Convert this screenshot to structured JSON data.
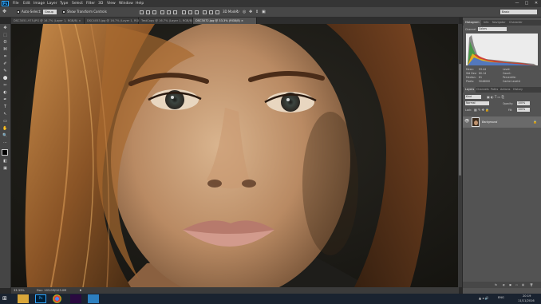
{
  "app": {
    "logo": "Ps",
    "menu": [
      "File",
      "Edit",
      "Image",
      "Layer",
      "Type",
      "Select",
      "Filter",
      "3D",
      "View",
      "Window",
      "Help"
    ]
  },
  "window_controls": {
    "minimize": "—",
    "maximize": "□",
    "close": "✕"
  },
  "options": {
    "auto_select_label": "Auto-Select:",
    "auto_select_value": "Group",
    "transform_label": "Show Transform Controls",
    "mode_3d": "3D Mode:",
    "workspace": "Basic"
  },
  "tabs": [
    {
      "label": "DSC3051-975.JPG @ 16.7% (Layer 1, RGB/8) ×"
    },
    {
      "label": "DSC4053.jpg @ 16.7% (Layer 1, RGB/8) ×"
    },
    {
      "label": "TestCopy @ 16.7% (Layer 1, RGB/8) ×"
    },
    {
      "label": "DSC3072.jpg @ 33.3% (RGB/8) ×",
      "active": true
    }
  ],
  "tools": [
    "✥",
    "⬚",
    "ʘ",
    "⌘",
    "⌗",
    "✐",
    "✎",
    "⬤",
    "✂",
    "◐",
    "✒",
    "T",
    "↖",
    "▭",
    "✋",
    "🔍",
    "⋯",
    "◧",
    "▣",
    "⎘"
  ],
  "status": {
    "zoom": "33.33%",
    "doc": "Doc: 103.0M/103.0M"
  },
  "histogram_panel": {
    "tabs": [
      "Histogram",
      "Info",
      "Navigator",
      "Character"
    ],
    "channel_label": "Channel:",
    "channel_value": "Colors",
    "stats": [
      {
        "label": "Mean:",
        "value": "93.44"
      },
      {
        "label": "Std Dev:",
        "value": "60.14"
      },
      {
        "label": "Median:",
        "value": "81"
      },
      {
        "label": "Pixels:",
        "value": "5046000"
      }
    ],
    "stats_right": [
      {
        "label": "Level:",
        "value": ""
      },
      {
        "label": "Count:",
        "value": ""
      },
      {
        "label": "Percentile:",
        "value": ""
      },
      {
        "label": "Cache Level:",
        "value": "4"
      }
    ]
  },
  "layers_panel": {
    "tabs": [
      "Layers",
      "Channels",
      "Paths",
      "Actions",
      "History"
    ],
    "kind": "Kind",
    "blend": "Normal",
    "opacity_label": "Opacity:",
    "opacity_value": "100%",
    "lock_label": "Lock:",
    "fill_label": "Fill:",
    "fill_value": "100%",
    "layer_name": "Background",
    "bottom_icons": [
      "fx",
      "◐",
      "▣",
      "▭",
      "▤",
      "🗑"
    ]
  },
  "taskbar": {
    "apps": [
      "Explorer",
      "Photoshop",
      "Chrome",
      "Premiere",
      "Camera"
    ],
    "time": "20:19",
    "date": "11/11/2016",
    "lang": "ENG"
  },
  "colors": {
    "ui_dark": "#353535",
    "ui_panel": "#535353",
    "accent": "#31a8ff"
  }
}
